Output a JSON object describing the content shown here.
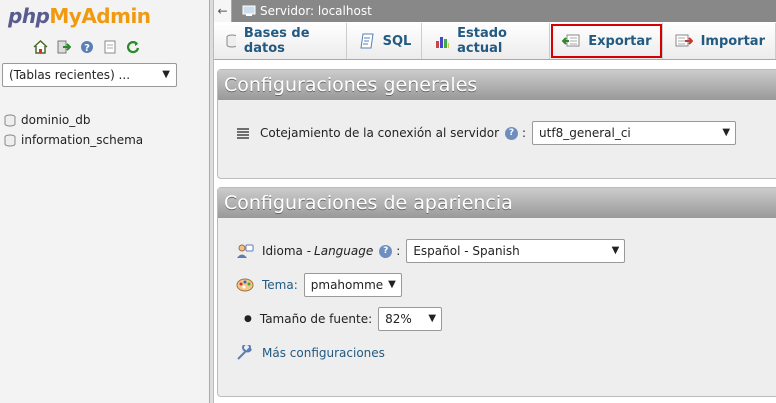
{
  "nav": {
    "logo_php": "php",
    "logo_pma": "MyAdmin",
    "recent_placeholder": "(Tablas recientes) ...",
    "databases": [
      "dominio_db",
      "information_schema"
    ],
    "icons": [
      "home-icon",
      "logout-icon",
      "help-icon",
      "documentation-icon",
      "reload-icon"
    ]
  },
  "serverbar": {
    "back_glyph": "←",
    "label": "Servidor: localhost"
  },
  "tabs": [
    {
      "label": "Bases de datos",
      "icon": "database-icon"
    },
    {
      "label": "SQL",
      "icon": "sql-icon"
    },
    {
      "label": "Estado actual",
      "icon": "status-icon"
    },
    {
      "label": "Exportar",
      "icon": "export-icon",
      "highlighted": true
    },
    {
      "label": "Importar",
      "icon": "import-icon"
    }
  ],
  "general": {
    "legend": "Configuraciones generales",
    "collation_label": "Cotejamiento de la conexión al servidor",
    "collation_colon": ":",
    "collation_value": "utf8_general_ci"
  },
  "appearance": {
    "legend": "Configuraciones de apariencia",
    "language_label": "Idioma - ",
    "language_label_em": "Language",
    "language_colon": ":",
    "language_value": "Español - Spanish",
    "theme_label": "Tema:",
    "theme_value": "pmahomme",
    "font_label": "Tamaño de fuente:",
    "font_value": "82%",
    "more_link": "Más configuraciones"
  },
  "colors": {
    "link": "#235a81",
    "highlight_border": "#d50000",
    "legend_bg": "#999999"
  }
}
